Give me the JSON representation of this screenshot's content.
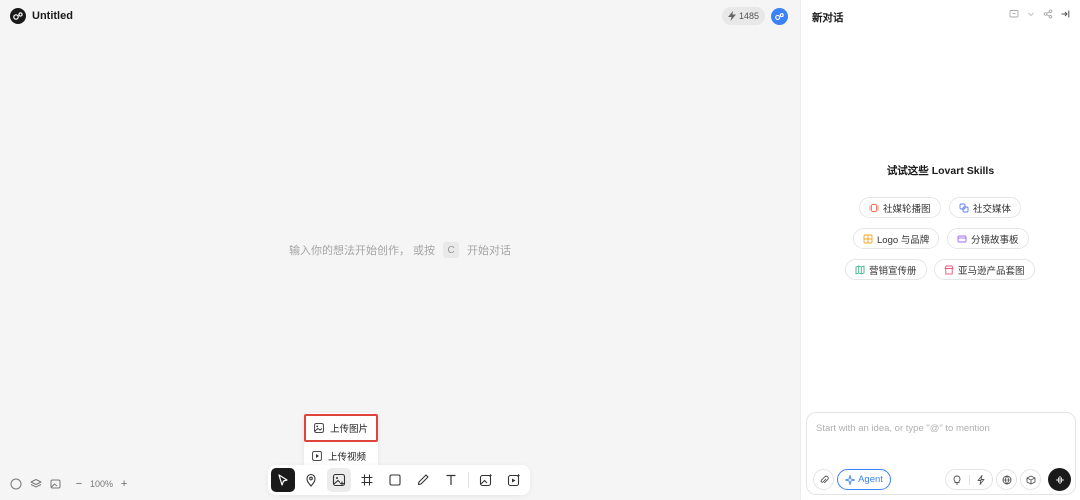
{
  "app": {
    "title": "Untitled",
    "credits": "1485"
  },
  "canvas": {
    "hint_before": "输入你的想法开始创作，  或按",
    "hint_key": "C",
    "hint_after": "开始对话",
    "zoom": "100%"
  },
  "upload_menu": {
    "items": [
      {
        "label": "上传图片",
        "icon": "image-upload-icon",
        "highlighted": true
      },
      {
        "label": "上传视频",
        "icon": "video-upload-icon",
        "highlighted": false
      }
    ]
  },
  "toolbar": {
    "tools": [
      "select-tool",
      "marker-tool",
      "image-tool",
      "frame-tool",
      "rectangle-tool",
      "pen-tool",
      "text-tool",
      "image-generator-tool",
      "video-generator-tool"
    ]
  },
  "panel": {
    "header": "新对话",
    "skills_title": "试试这些 Lovart Skills",
    "skills": [
      {
        "label": "社媒轮播图",
        "color": "#f0735a"
      },
      {
        "label": "社交媒体",
        "color": "#5b7cf0"
      },
      {
        "label": "Logo 与品牌",
        "color": "#f5a623"
      },
      {
        "label": "分镜故事板",
        "color": "#9b6cf0"
      },
      {
        "label": "营销宣传册",
        "color": "#3bb38b"
      },
      {
        "label": "亚马逊产品套图",
        "color": "#e8557a"
      }
    ],
    "composer": {
      "placeholder": "Start with an idea, or type \"@\" to mention",
      "agent_label": "Agent"
    }
  },
  "colors": {
    "accent": "#3b82f6",
    "highlight_border": "#e0433a"
  }
}
